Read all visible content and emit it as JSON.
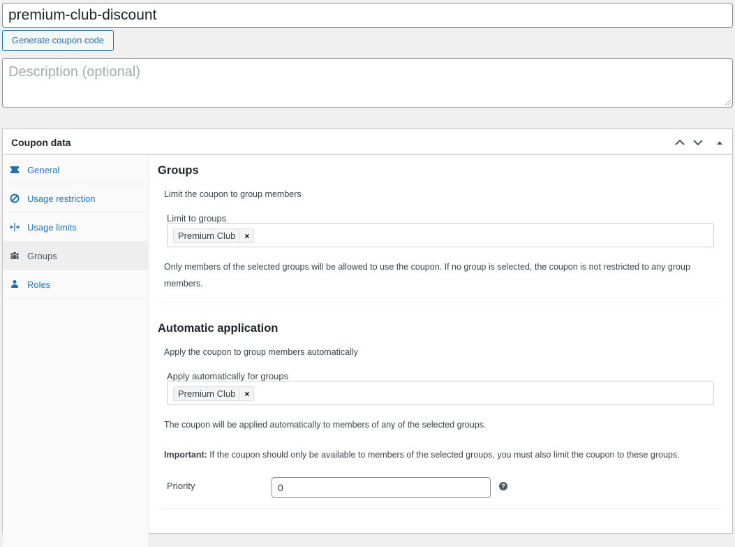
{
  "coupon": {
    "code": "premium-club-discount",
    "generate_label": "Generate coupon code",
    "description_placeholder": "Description (optional)"
  },
  "panel": {
    "title": "Coupon data"
  },
  "sidebar": {
    "items": [
      {
        "label": "General",
        "icon": "ticket-icon"
      },
      {
        "label": "Usage restriction",
        "icon": "ban-icon"
      },
      {
        "label": "Usage limits",
        "icon": "limits-icon"
      },
      {
        "label": "Groups",
        "icon": "groups-icon"
      },
      {
        "label": "Roles",
        "icon": "user-icon"
      }
    ],
    "active": "Groups"
  },
  "groups": {
    "heading": "Groups",
    "intro": "Limit the coupon to group members",
    "field_label": "Limit to groups",
    "selected": [
      "Premium Club"
    ],
    "chip_remove": "×",
    "note_line1": "Only members of the selected groups will be allowed to use the coupon. If no group is selected, the coupon is not restricted to any group",
    "note_line2": "members."
  },
  "auto": {
    "heading": "Automatic application",
    "intro": "Apply the coupon to group members automatically",
    "field_label": "Apply automatically for groups",
    "selected": [
      "Premium Club"
    ],
    "chip_remove": "×",
    "note": "The coupon will be applied automatically to members of any of the selected groups.",
    "important_label": "Important:",
    "important_text": " If the coupon should only be available to members of the selected groups, you must also limit the coupon to these groups.",
    "priority_label": "Priority",
    "priority_value": "0",
    "help_glyph": "?"
  },
  "colors": {
    "accent": "#2271b1",
    "background": "#f0f0f1",
    "active_tab": "#eeeeee"
  }
}
